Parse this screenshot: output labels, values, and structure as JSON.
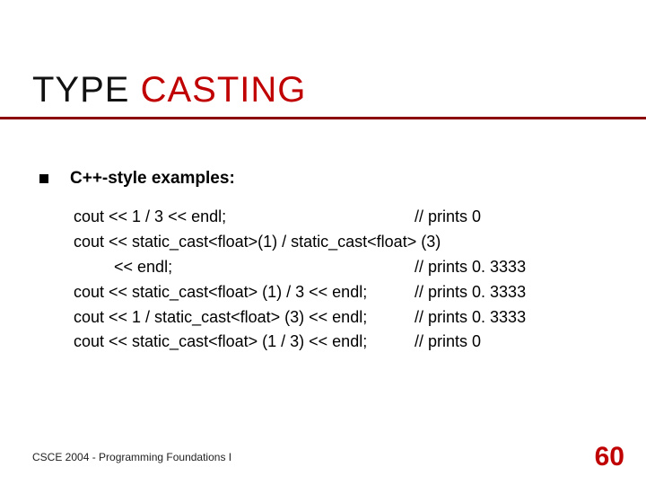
{
  "title": {
    "black": "TYPE",
    "red": " CASTING"
  },
  "bullet": "C++-style examples:",
  "code": {
    "line1_l": "cout << 1 / 3 << endl;",
    "line1_r": "// prints 0",
    "line2": "cout << static_cast<float>(1) / static_cast<float> (3)",
    "line3_l": "         << endl;",
    "line3_r": "// prints 0. 3333",
    "line4_l": "cout << static_cast<float> (1) / 3 << endl;",
    "line4_r": "// prints 0. 3333",
    "line5_l": "cout << 1 / static_cast<float> (3) << endl;",
    "line5_r": "// prints 0. 3333",
    "line6_l": "cout << static_cast<float> (1 / 3) << endl;",
    "line6_r": "// prints 0"
  },
  "footer": "CSCE 2004 - Programming Foundations I",
  "page": "60"
}
